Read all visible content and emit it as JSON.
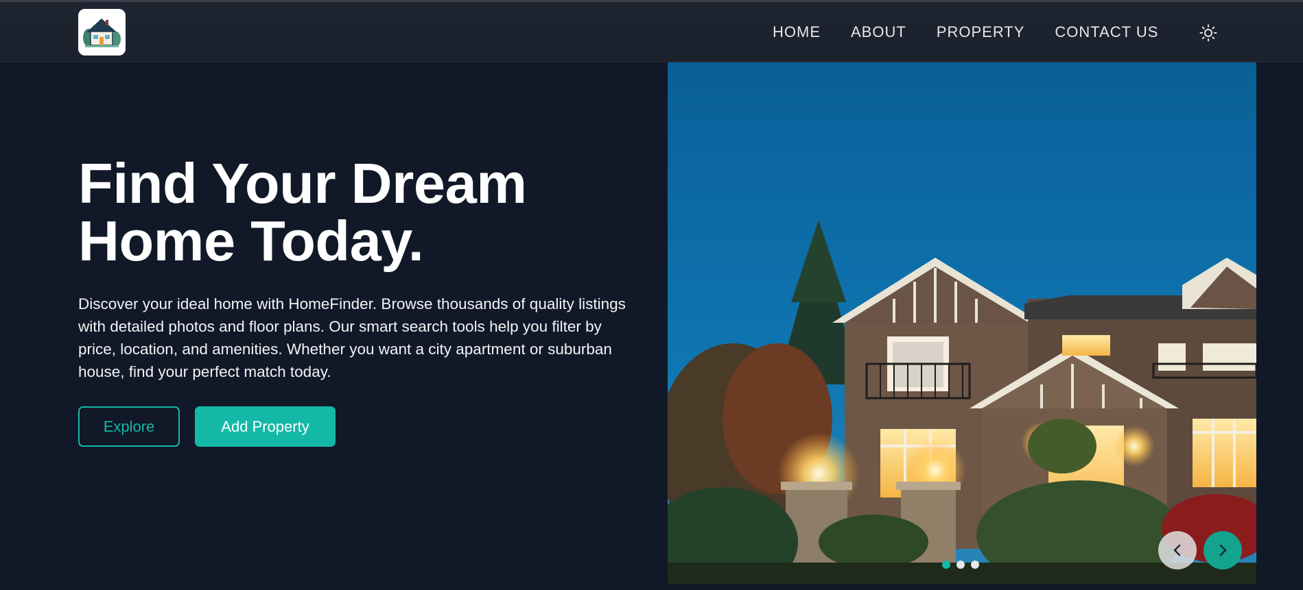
{
  "nav": {
    "logo_icon": "house-logo-icon",
    "links": [
      {
        "label": "HOME"
      },
      {
        "label": "ABOUT"
      },
      {
        "label": "PROPERTY"
      },
      {
        "label": "CONTACT US"
      }
    ],
    "theme_icon": "sun-icon"
  },
  "hero": {
    "title_line1": "Find Your Dream",
    "title_line2": "Home Today.",
    "description": "Discover your ideal home with HomeFinder. Browse thousands of quality listings with detailed photos and floor plans. Our smart search tools help you filter by price, location, and amenities. Whether you want a city apartment or suburban house, find your perfect match today.",
    "explore_label": "Explore",
    "add_property_label": "Add Property"
  },
  "carousel": {
    "slide_count": 3,
    "active_slide": 1,
    "prev_icon": "chevron-left-icon",
    "next_icon": "chevron-right-icon"
  },
  "colors": {
    "background": "#111827",
    "navbar": "#1d2430",
    "accent": "#14b8a6"
  }
}
